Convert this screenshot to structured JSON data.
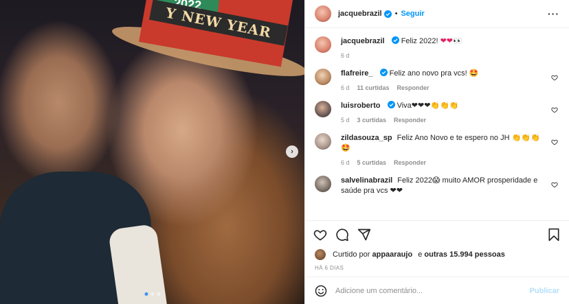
{
  "photo": {
    "hat_year": "2022",
    "hat_text": "Y NEW YEAR",
    "carousel_next": "›",
    "slides_total": 3,
    "slide_active": 1
  },
  "header": {
    "username": "jacquebrazil",
    "separator": "•",
    "follow_label": "Seguir",
    "more": "···"
  },
  "caption": {
    "username": "jacquebrazil",
    "text": "Feliz 2022!",
    "emojis": "❤❤👀",
    "time": "6 d"
  },
  "comments": [
    {
      "username": "flafreire_",
      "verified": true,
      "text": "Feliz ano novo pra vcs! 🤩",
      "time": "6 d",
      "likes": "11 curtidas",
      "reply": "Responder"
    },
    {
      "username": "luisroberto",
      "verified": true,
      "text": "Viva❤❤❤👏👏👏",
      "time": "5 d",
      "likes": "3 curtidas",
      "reply": "Responder"
    },
    {
      "username": "zildasouza_sp",
      "verified": false,
      "text": "Feliz Ano Novo e te espero no JH 👏👏👏🤩",
      "time": "6 d",
      "likes": "5 curtidas",
      "reply": "Responder"
    },
    {
      "username": "salvelinabrazil",
      "verified": false,
      "text": "Feliz 2022😱 muito AMOR prosperidade e saúde pra vcs ❤❤",
      "time": "",
      "likes": "",
      "reply": ""
    }
  ],
  "likes": {
    "prefix": "Curtido por",
    "user": "appaaraujo",
    "middle": "e",
    "others": "outras 15.994 pessoas"
  },
  "date": "HÁ 6 DIAS",
  "add_comment": {
    "placeholder": "Adicione um comentário...",
    "post_label": "Publicar"
  },
  "colors": {
    "accent": "#0095f6",
    "heart": "#e0245e",
    "muted": "#8e8e8e"
  }
}
